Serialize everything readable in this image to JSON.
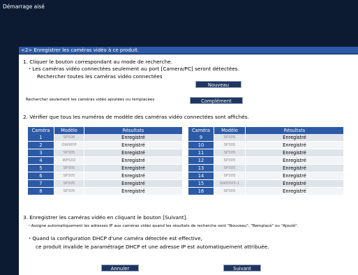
{
  "window": {
    "title": "Démarrage aisé"
  },
  "step_header": "<2> Enregistrer les caméras vidéo à ce produit.",
  "section1": {
    "title": "1. Cliquer le bouton correspondant au mode de recherche.",
    "note": "・Les caméras vidéo connectées seulement au port [Camera/PC] seront détectées.",
    "search_all_label": "Rechercher toutes les caméras vidéo connectées",
    "search_all_button": "Nouveau",
    "search_added_label": "Rechercher seulement les caméras vidéo ajoutées ou remplacées",
    "search_added_button": "Complément"
  },
  "section2": {
    "title": "2. Vérifier que tous les numéros de modèle des caméras vidéo connectées sont affichés.",
    "headers": [
      "Caméra",
      "Modèle",
      "Résultats"
    ],
    "left_rows": [
      {
        "cam": "1",
        "model": "SP508",
        "result": "Enregistré"
      },
      {
        "cam": "2",
        "model": "OWWYP",
        "result": "Enregistré"
      },
      {
        "cam": "3",
        "model": "SP305",
        "result": "Enregistré"
      },
      {
        "cam": "4",
        "model": "WPS02",
        "result": "Enregistré"
      },
      {
        "cam": "5",
        "model": "SP305",
        "result": "Enregistré"
      },
      {
        "cam": "6",
        "model": "SP305",
        "result": "Enregistré"
      },
      {
        "cam": "7",
        "model": "SP305",
        "result": "Enregistré"
      },
      {
        "cam": "8",
        "model": "SP305",
        "result": "Enregistré"
      }
    ],
    "right_rows": [
      {
        "cam": "9",
        "model": "SP305",
        "result": "Enregistré"
      },
      {
        "cam": "10",
        "model": "SP305",
        "result": "Enregistré"
      },
      {
        "cam": "11",
        "model": "SP305",
        "result": "Enregistré"
      },
      {
        "cam": "12",
        "model": "SP305",
        "result": "Enregistré"
      },
      {
        "cam": "13",
        "model": "SP305",
        "result": "Enregistré"
      },
      {
        "cam": "14",
        "model": "SP305",
        "result": "Enregistré"
      },
      {
        "cam": "15",
        "model": "SWD505-1",
        "result": "Enregistré"
      },
      {
        "cam": "16",
        "model": "SP305",
        "result": "Enregistré"
      }
    ]
  },
  "section3": {
    "title": "3. Enregistrer les caméras vidéo en cliquant le bouton [Suivant].",
    "note": "・Assigne automatiquement les adresses IP aux caméras vidéo quand les résultats de recherche sont \"Nouveau\", \"Remplacé\" ou \"Ajouté\".",
    "dhcp_line1": "・Quand la configuration DHCP d'une caméra détectée est effective,",
    "dhcp_line2": "ce produit invalide le paramétrage DHCP et une adresse IP est automatiquement attribuée."
  },
  "footer": {
    "cancel": "Annuler",
    "next": "Suivant"
  },
  "colors": {
    "background": "#0c1a32",
    "accent": "#2c5aa6",
    "button": "#1e3660"
  }
}
